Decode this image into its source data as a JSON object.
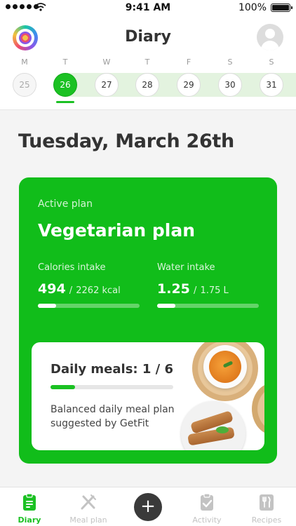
{
  "status_bar": {
    "time": "9:41 AM",
    "battery": "100%"
  },
  "header": {
    "title": "Diary"
  },
  "week": {
    "days": [
      {
        "letter": "M",
        "date": "25",
        "state": "past"
      },
      {
        "letter": "T",
        "date": "26",
        "state": "current"
      },
      {
        "letter": "W",
        "date": "27",
        "state": "upcoming"
      },
      {
        "letter": "T",
        "date": "28",
        "state": "upcoming"
      },
      {
        "letter": "F",
        "date": "29",
        "state": "upcoming"
      },
      {
        "letter": "S",
        "date": "30",
        "state": "upcoming"
      },
      {
        "letter": "S",
        "date": "31",
        "state": "upcoming"
      }
    ]
  },
  "main": {
    "date_heading": "Tuesday, March 26th"
  },
  "plan": {
    "caption": "Active plan",
    "name": "Vegetarian plan",
    "calories": {
      "label": "Calories intake",
      "value": "494",
      "separator": "/",
      "target": "2262 kcal",
      "progress": 0.18
    },
    "water": {
      "label": "Water intake",
      "value": "1.25",
      "separator": "/",
      "target": "1.75 L",
      "progress": 0.18
    }
  },
  "meals": {
    "title": "Daily meals: 1 / 6",
    "progress": 0.2,
    "description": "Balanced daily meal plan suggested by GetFit"
  },
  "tabbar": {
    "tabs": [
      {
        "id": "diary",
        "label": "Diary",
        "icon": "clipboard-icon",
        "active": true
      },
      {
        "id": "meal_plan",
        "label": "Meal plan",
        "icon": "fork-knife-icon",
        "active": false
      },
      {
        "id": "activity",
        "label": "Activity",
        "icon": "checklist-icon",
        "active": false
      },
      {
        "id": "recipes",
        "label": "Recipes",
        "icon": "cutlery-card-icon",
        "active": false
      }
    ],
    "add_label": "+"
  },
  "colors": {
    "accent": "#1bc123",
    "card": "#11bd1a",
    "inactive": "#c3c3c3"
  }
}
